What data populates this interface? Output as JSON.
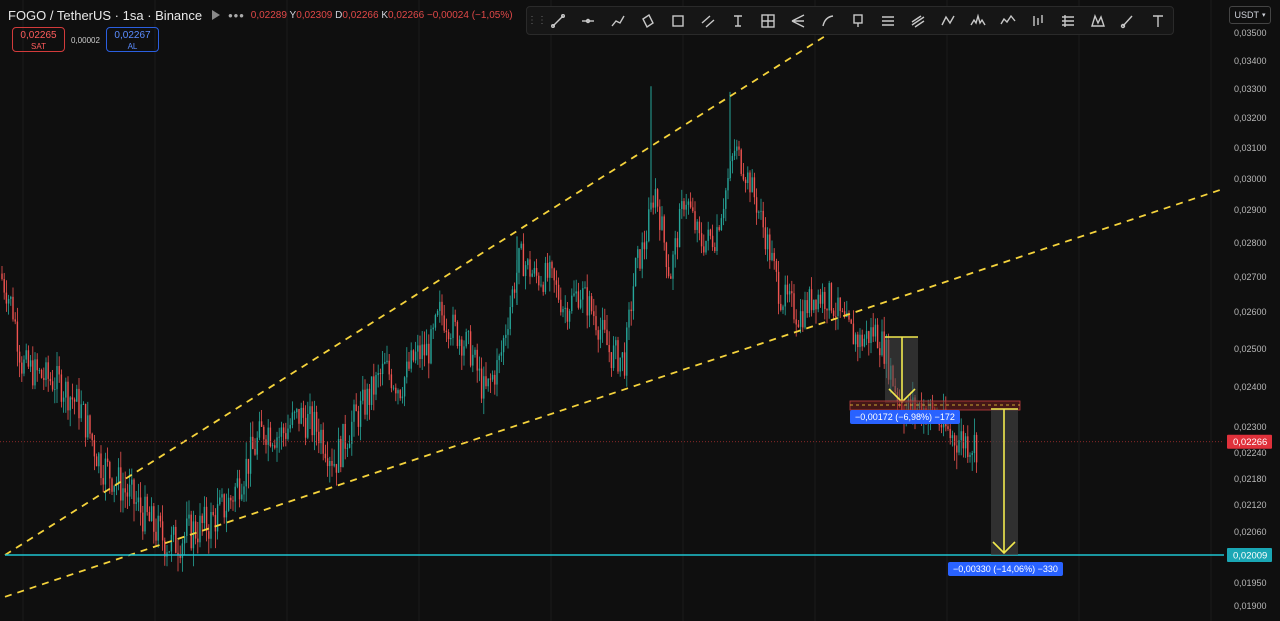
{
  "header": {
    "symbol_title": "FOGO / TetherUS · 1sa · Binance",
    "ohlc": {
      "o_label": "A",
      "o_value": "0,02289",
      "h_label": "Y",
      "h_value": "0,02309",
      "l_label": "D",
      "l_value": "0,02266",
      "c_label": "K",
      "c_value": "0,02266",
      "change": "−0,00024 (−1,05%)"
    }
  },
  "trade": {
    "sell_price": "0,02265",
    "sell_label": "SAT",
    "spread": "0,00002",
    "buy_price": "0,02267",
    "buy_label": "AL"
  },
  "toolbar": {
    "tools": [
      "trend-line-icon",
      "horizontal-ray-icon",
      "polyline-icon",
      "rectangle-rotated-icon",
      "rectangle-icon",
      "parallel-channel-icon",
      "text-cursor-icon",
      "grid-icon",
      "pitchfork-icon",
      "arc-icon",
      "price-note-icon",
      "fib-retracement-icon",
      "fib-channel-icon",
      "pattern-icon",
      "head-shoulders-icon",
      "elliott-wave-icon",
      "bars-pattern-icon",
      "fib-levels-icon",
      "xabcd-icon",
      "brush-icon",
      "text-icon"
    ]
  },
  "currency": "USDT",
  "price_axis": {
    "ticks": [
      "0,03500",
      "0,03400",
      "0,03300",
      "0,03200",
      "0,03100",
      "0,03000",
      "0,02900",
      "0,02800",
      "0,02700",
      "0,02600",
      "0,02500",
      "0,02400",
      "0,02300",
      "0,02240",
      "0,02180",
      "0,02120",
      "0,02060",
      "0,01950",
      "0,01900"
    ],
    "current_price": "0,02266",
    "level_price": "0,02009"
  },
  "measurements": {
    "first": "−0,00172 (−6,98%) −172",
    "second": "−0,00330 (−14,06%) −330"
  },
  "colors": {
    "up": "#26a69a",
    "down": "#ef5350",
    "trend": "#f5d33c",
    "level": "#1fc3d0",
    "measure_label": "#2962ff",
    "current_price_bg": "#e0313b",
    "level_bg": "#1aa7b5"
  },
  "chart_data": {
    "type": "candlestick",
    "description_keys": [
      "price_axis",
      "measurements"
    ],
    "price_range": [
      0.0188,
      0.0352
    ],
    "close_path": [
      [
        0,
        0.0271
      ],
      [
        12,
        0.0262
      ],
      [
        22,
        0.0246
      ],
      [
        40,
        0.0243
      ],
      [
        60,
        0.0241
      ],
      [
        80,
        0.0235
      ],
      [
        100,
        0.0222
      ],
      [
        115,
        0.0218
      ],
      [
        130,
        0.0214
      ],
      [
        150,
        0.0208
      ],
      [
        170,
        0.0203
      ],
      [
        190,
        0.0206
      ],
      [
        210,
        0.0208
      ],
      [
        230,
        0.0213
      ],
      [
        250,
        0.0223
      ],
      [
        265,
        0.023
      ],
      [
        280,
        0.0228
      ],
      [
        300,
        0.0233
      ],
      [
        320,
        0.0229
      ],
      [
        335,
        0.0222
      ],
      [
        350,
        0.023
      ],
      [
        370,
        0.0238
      ],
      [
        385,
        0.0245
      ],
      [
        400,
        0.024
      ],
      [
        415,
        0.0248
      ],
      [
        430,
        0.025
      ],
      [
        440,
        0.026
      ],
      [
        455,
        0.0255
      ],
      [
        470,
        0.025
      ],
      [
        485,
        0.0238
      ],
      [
        500,
        0.0247
      ],
      [
        510,
        0.0262
      ],
      [
        520,
        0.0276
      ],
      [
        535,
        0.027
      ],
      [
        550,
        0.027
      ],
      [
        565,
        0.0261
      ],
      [
        580,
        0.0266
      ],
      [
        595,
        0.0259
      ],
      [
        610,
        0.0249
      ],
      [
        625,
        0.0247
      ],
      [
        635,
        0.0272
      ],
      [
        645,
        0.028
      ],
      [
        655,
        0.0297
      ],
      [
        670,
        0.027
      ],
      [
        685,
        0.0295
      ],
      [
        700,
        0.028
      ],
      [
        715,
        0.0282
      ],
      [
        725,
        0.0295
      ],
      [
        735,
        0.031
      ],
      [
        750,
        0.0299
      ],
      [
        765,
        0.0283
      ],
      [
        780,
        0.0265
      ],
      [
        800,
        0.0259
      ],
      [
        815,
        0.0265
      ],
      [
        830,
        0.0264
      ],
      [
        845,
        0.0256
      ],
      [
        860,
        0.0252
      ],
      [
        875,
        0.0255
      ],
      [
        885,
        0.025
      ],
      [
        895,
        0.024
      ],
      [
        905,
        0.0234
      ],
      [
        920,
        0.0235
      ],
      [
        935,
        0.0233
      ],
      [
        950,
        0.0228
      ],
      [
        965,
        0.0227
      ],
      [
        978,
        0.0226
      ]
    ],
    "trend_lines": [
      {
        "from": [
          5,
          0.02009
        ],
        "to": [
          830,
          0.0353
        ]
      },
      {
        "from": [
          5,
          0.0192
        ],
        "to": [
          1225,
          0.0297
        ]
      }
    ],
    "horizontal_level": 0.02009,
    "current_price": 0.02266
  }
}
